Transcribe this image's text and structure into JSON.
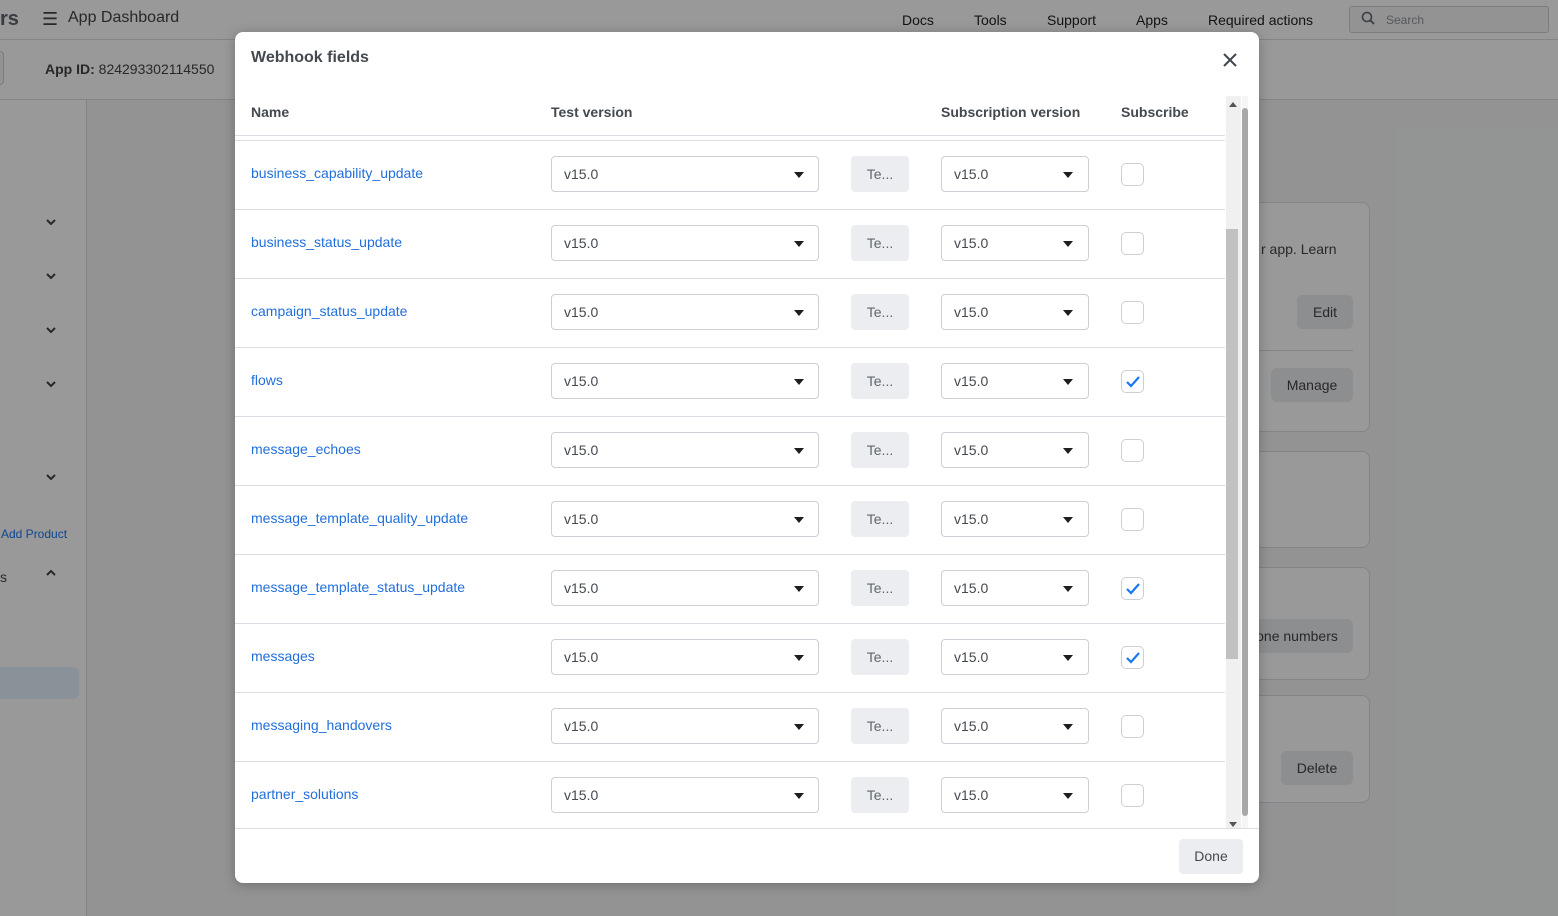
{
  "background": {
    "brand_fragment": "rs",
    "menu_icon": "☰",
    "app_title": "App Dashboard",
    "nav": [
      "Docs",
      "Tools",
      "Support",
      "Apps",
      "Required actions"
    ],
    "search_placeholder": "Search",
    "app_id_label": "App ID:",
    "app_id_value": "824293302114550",
    "add_product": "Add Product",
    "side_fragment": "s",
    "card_text": "r app. Learn",
    "buttons": {
      "edit": "Edit",
      "manage": "Manage",
      "phone_numbers": "one numbers",
      "delete": "Delete"
    }
  },
  "modal": {
    "title": "Webhook fields",
    "columns": {
      "name": "Name",
      "test_version": "Test version",
      "subscription_version": "Subscription version",
      "subscribe": "Subscribe"
    },
    "test_button_label": "Te...",
    "rows": [
      {
        "name": "business_capability_update",
        "test_version": "v15.0",
        "subscription_version": "v15.0",
        "subscribed": false
      },
      {
        "name": "business_status_update",
        "test_version": "v15.0",
        "subscription_version": "v15.0",
        "subscribed": false
      },
      {
        "name": "campaign_status_update",
        "test_version": "v15.0",
        "subscription_version": "v15.0",
        "subscribed": false
      },
      {
        "name": "flows",
        "test_version": "v15.0",
        "subscription_version": "v15.0",
        "subscribed": true
      },
      {
        "name": "message_echoes",
        "test_version": "v15.0",
        "subscription_version": "v15.0",
        "subscribed": false
      },
      {
        "name": "message_template_quality_update",
        "test_version": "v15.0",
        "subscription_version": "v15.0",
        "subscribed": false
      },
      {
        "name": "message_template_status_update",
        "test_version": "v15.0",
        "subscription_version": "v15.0",
        "subscribed": true
      },
      {
        "name": "messages",
        "test_version": "v15.0",
        "subscription_version": "v15.0",
        "subscribed": true
      },
      {
        "name": "messaging_handovers",
        "test_version": "v15.0",
        "subscription_version": "v15.0",
        "subscribed": false
      },
      {
        "name": "partner_solutions",
        "test_version": "v15.0",
        "subscription_version": "v15.0",
        "subscribed": false
      }
    ],
    "done_label": "Done"
  },
  "colors": {
    "link": "#216fdb",
    "checkbox_check": "#1877f2",
    "overlay": "rgba(0,0,0,0.4)"
  },
  "icons": {
    "close": "close-icon",
    "caret": "caret-down-icon",
    "check": "checkmark-icon",
    "search": "search-icon",
    "chevron": "chevron-down-icon"
  }
}
